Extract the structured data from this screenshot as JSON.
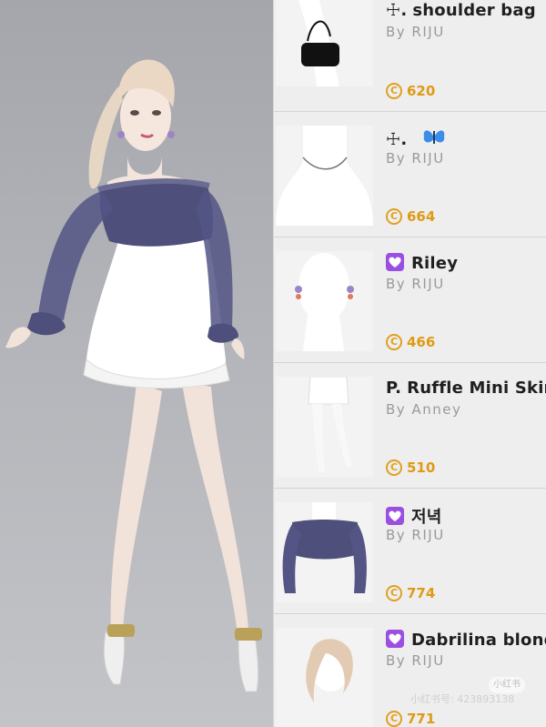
{
  "colors": {
    "accent_coin": "#e0a020",
    "heart_badge": "#9b4fe0",
    "top_garment": "#4e4f7a",
    "skirt": "#ffffff"
  },
  "items": [
    {
      "prefix": "☩.",
      "badge": "",
      "name": "shoulder bag",
      "creator": "By RIJU",
      "price": "620",
      "thumb_icon": "shoulder-bag-thumbnail"
    },
    {
      "prefix": "☩.",
      "badge": "butterfly-emoji",
      "name": "",
      "creator": "By RIJU",
      "price": "664",
      "thumb_icon": "necklace-thumbnail"
    },
    {
      "prefix": "",
      "badge": "purple-heart",
      "name": "Riley",
      "creator": "By RIJU",
      "price": "466",
      "thumb_icon": "earrings-thumbnail"
    },
    {
      "prefix": "P.",
      "badge": "",
      "name": "Ruffle Mini Skirt",
      "creator": "By Anney",
      "price": "510",
      "thumb_icon": "skirt-thumbnail"
    },
    {
      "prefix": "",
      "badge": "purple-heart",
      "name": "저녁",
      "creator": "By RIJU",
      "price": "774",
      "thumb_icon": "off-shoulder-top-thumbnail"
    },
    {
      "prefix": "",
      "badge": "purple-heart",
      "name": "Dabrilina blond",
      "creator": "By RIJU",
      "price": "771",
      "thumb_icon": "blonde-hair-thumbnail"
    }
  ],
  "coin_symbol": "C",
  "watermark": {
    "badge": "小红书",
    "text": "小红书号: 423893138"
  }
}
